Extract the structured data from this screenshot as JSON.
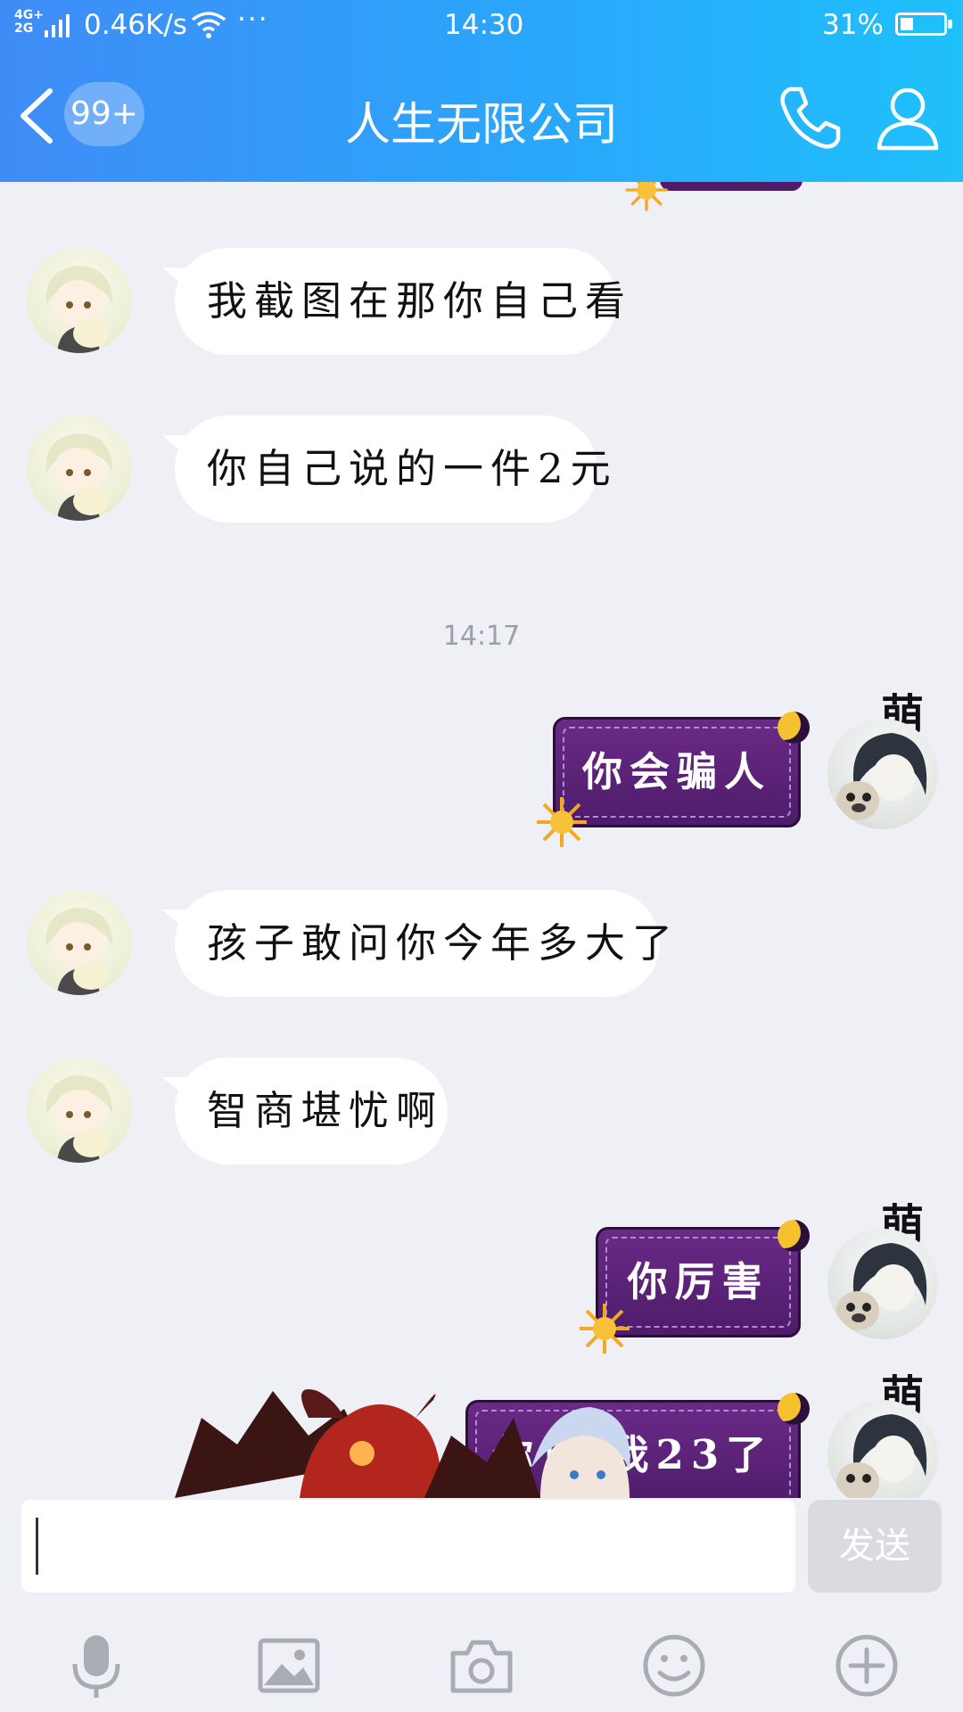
{
  "status_bar": {
    "network": "4G+ 2G",
    "speed": "0.46K/s",
    "more": "···",
    "time": "14:30",
    "battery": "31%"
  },
  "nav": {
    "unread_badge": "99+",
    "title": "人生无限公司"
  },
  "messages": [
    {
      "side": "in",
      "text": "我截图在那你自己看"
    },
    {
      "side": "in",
      "text": "你自己说的一件2元"
    },
    {
      "side": "time",
      "text": "14:17"
    },
    {
      "side": "out",
      "text": "你会骗人",
      "tag": "萌"
    },
    {
      "side": "in",
      "text": "孩子敢问你今年多大了"
    },
    {
      "side": "in",
      "text": "智商堪忧啊"
    },
    {
      "side": "out",
      "text": "你厉害",
      "tag": "萌"
    },
    {
      "side": "out",
      "text": "你说 我23了",
      "tag": "萌"
    }
  ],
  "input": {
    "value": "",
    "send_label": "发送"
  },
  "toolbar_icons": [
    "microphone-icon",
    "image-icon",
    "camera-icon",
    "emoji-icon",
    "plus-icon"
  ],
  "colors": {
    "header_start": "#3f8cf6",
    "header_end": "#1fc0fb",
    "chat_bg": "#eef0f6",
    "out_bubble": "#5a2276"
  }
}
